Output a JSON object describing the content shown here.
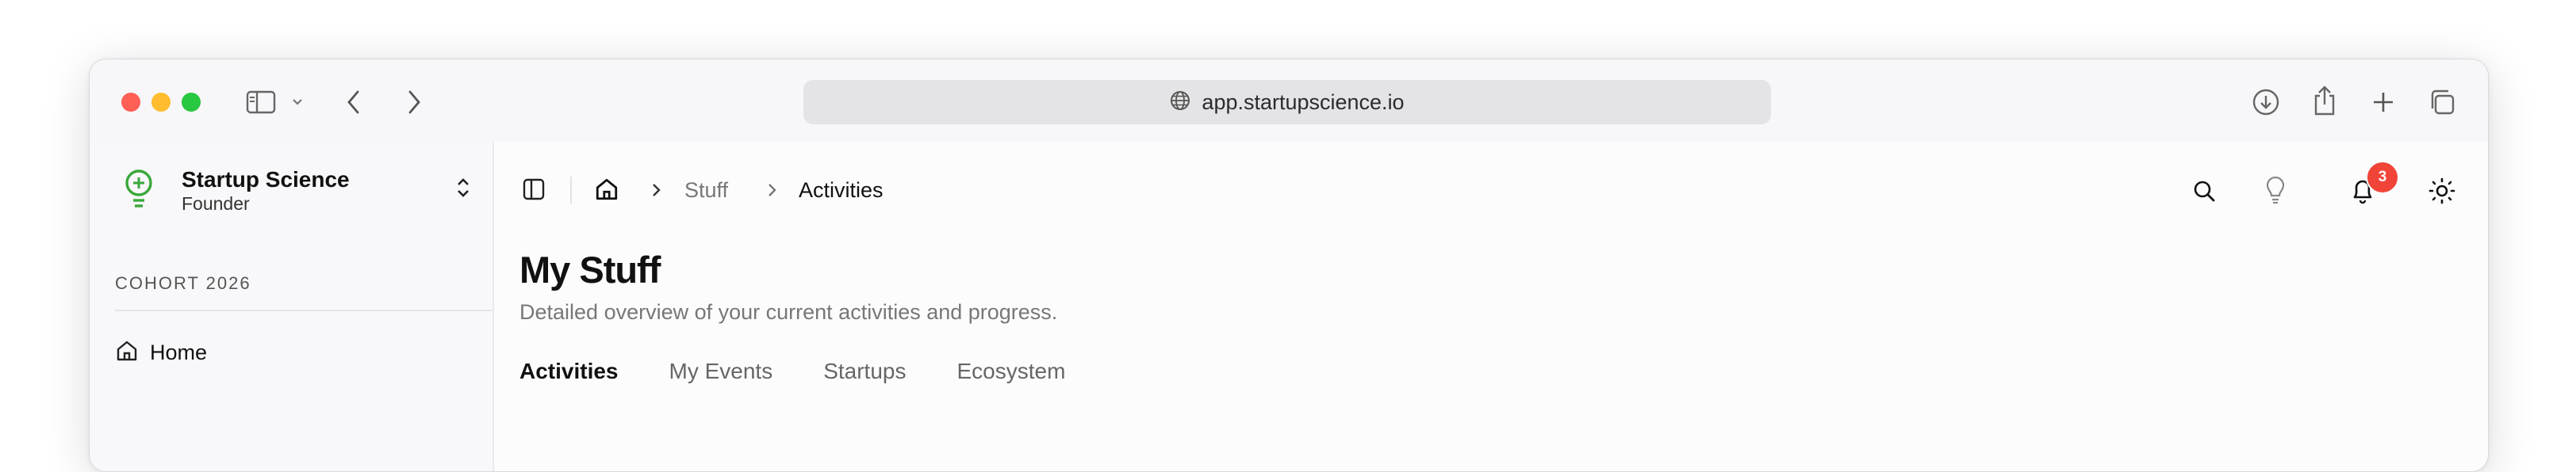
{
  "browser": {
    "url": "app.startupscience.io",
    "icons": [
      "sidebar-toggle-icon",
      "chevron-down-icon",
      "back-arrow-icon",
      "forward-arrow-icon",
      "globe-icon",
      "download-icon",
      "share-icon",
      "new-tab-plus-icon",
      "tab-overview-icon"
    ]
  },
  "sidebar": {
    "brand_name": "Startup Science",
    "brand_role": "Founder",
    "section_label": "COHORT 2026",
    "items": [
      {
        "label": "Home",
        "icon": "home-icon"
      }
    ]
  },
  "topbar": {
    "breadcrumb": [
      "Stuff",
      "Activities"
    ],
    "notification_count": "3",
    "icons": [
      "panel-toggle-icon",
      "home-icon",
      "search-icon",
      "lightbulb-icon",
      "bell-icon",
      "sun-icon",
      "avatar"
    ]
  },
  "page": {
    "title": "My Stuff",
    "subtitle": "Detailed overview of your current activities and progress.",
    "tabs": [
      {
        "label": "Activities",
        "active": true
      },
      {
        "label": "My Events",
        "active": false
      },
      {
        "label": "Startups",
        "active": false
      },
      {
        "label": "Ecosystem",
        "active": false
      }
    ]
  },
  "colors": {
    "badge": "#f04438",
    "brand_green": "#3aa83a",
    "traffic_red": "#fe5f57",
    "traffic_yellow": "#febc2e",
    "traffic_green": "#28c840"
  }
}
